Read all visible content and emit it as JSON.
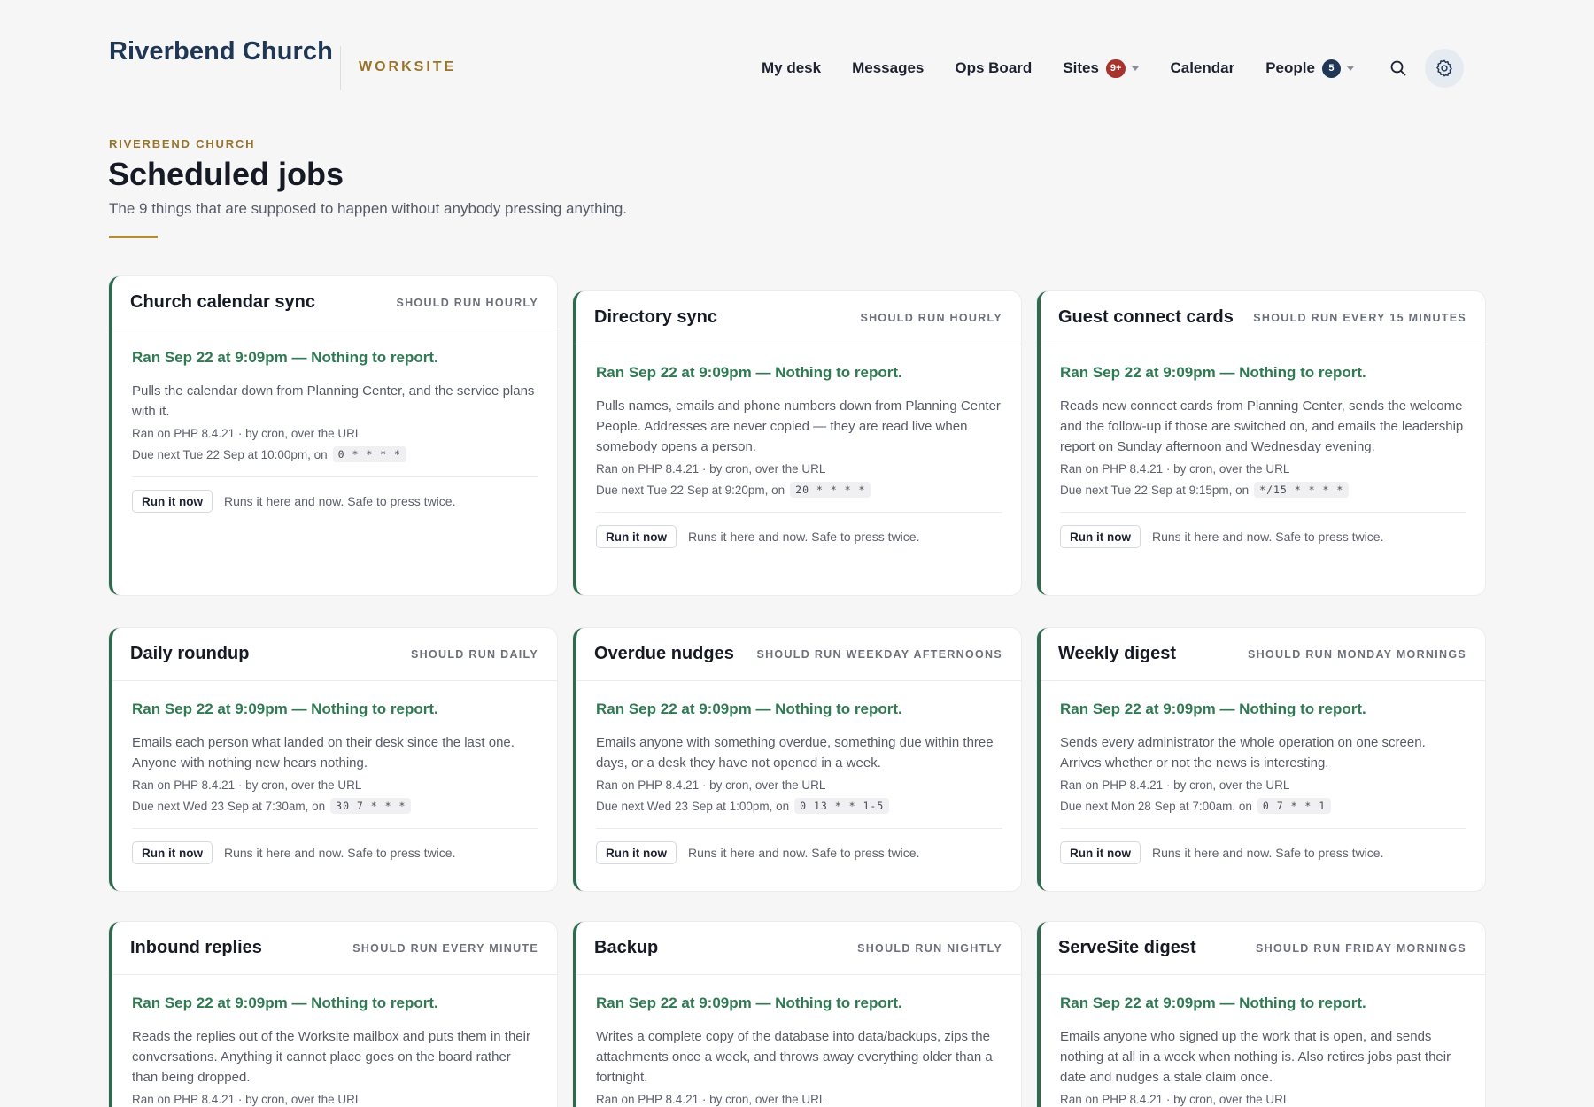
{
  "header": {
    "brand": "Riverbend Church",
    "brand_sub": "WORKSITE",
    "nav": {
      "my_desk": "My desk",
      "messages": "Messages",
      "ops_board": "Ops Board",
      "sites": "Sites",
      "sites_badge": "9+",
      "calendar": "Calendar",
      "people": "People",
      "people_badge": "5"
    },
    "icons": [
      "search-icon",
      "gear-icon",
      "chevron-down-icon"
    ]
  },
  "page": {
    "eyebrow": "RIVERBEND CHURCH",
    "title": "Scheduled jobs",
    "subtitle": "The 9 things that are supposed to happen without anybody pressing anything."
  },
  "colors": {
    "accent_gold": "#98742b",
    "brand_navy": "#1f3655",
    "status_green": "#2f7a52",
    "card_border_green": "#2f6a4f",
    "badge_red": "#a8322d"
  },
  "jobs": [
    {
      "title": "Church calendar sync",
      "frequency": "SHOULD RUN HOURLY",
      "status": "Ran Sep 22 at 9:09pm — Nothing to report.",
      "description": "Pulls the calendar down from Planning Center, and the service plans with it.",
      "meta": "Ran on PHP 8.4.21 · by cron, over the URL",
      "due": "Due next Tue 22 Sep at 10:00pm, on",
      "cron": "0 * * * *",
      "button": "Run it now",
      "note": "Runs it here and now. Safe to press twice."
    },
    {
      "title": "Directory sync",
      "frequency": "SHOULD RUN HOURLY",
      "status": "Ran Sep 22 at 9:09pm — Nothing to report.",
      "description": "Pulls names, emails and phone numbers down from Planning Center People. Addresses are never copied — they are read live when somebody opens a person.",
      "meta": "Ran on PHP 8.4.21 · by cron, over the URL",
      "due": "Due next Tue 22 Sep at 9:20pm, on",
      "cron": "20 * * * *",
      "button": "Run it now",
      "note": "Runs it here and now. Safe to press twice."
    },
    {
      "title": "Guest connect cards",
      "frequency": "SHOULD RUN EVERY 15 MINUTES",
      "status": "Ran Sep 22 at 9:09pm — Nothing to report.",
      "description": "Reads new connect cards from Planning Center, sends the welcome and the follow-up if those are switched on, and emails the leadership report on Sunday afternoon and Wednesday evening.",
      "meta": "Ran on PHP 8.4.21 · by cron, over the URL",
      "due": "Due next Tue 22 Sep at 9:15pm, on",
      "cron": "*/15 * * * *",
      "button": "Run it now",
      "note": "Runs it here and now. Safe to press twice."
    },
    {
      "title": "Daily roundup",
      "frequency": "SHOULD RUN DAILY",
      "status": "Ran Sep 22 at 9:09pm — Nothing to report.",
      "description": "Emails each person what landed on their desk since the last one. Anyone with nothing new hears nothing.",
      "meta": "Ran on PHP 8.4.21 · by cron, over the URL",
      "due": "Due next Wed 23 Sep at 7:30am, on",
      "cron": "30 7 * * *",
      "button": "Run it now",
      "note": "Runs it here and now. Safe to press twice."
    },
    {
      "title": "Overdue nudges",
      "frequency": "SHOULD RUN WEEKDAY AFTERNOONS",
      "status": "Ran Sep 22 at 9:09pm — Nothing to report.",
      "description": "Emails anyone with something overdue, something due within three days, or a desk they have not opened in a week.",
      "meta": "Ran on PHP 8.4.21 · by cron, over the URL",
      "due": "Due next Wed 23 Sep at 1:00pm, on",
      "cron": "0 13 * * 1-5",
      "button": "Run it now",
      "note": "Runs it here and now. Safe to press twice."
    },
    {
      "title": "Weekly digest",
      "frequency": "SHOULD RUN MONDAY MORNINGS",
      "status": "Ran Sep 22 at 9:09pm — Nothing to report.",
      "description": "Sends every administrator the whole operation on one screen. Arrives whether or not the news is interesting.",
      "meta": "Ran on PHP 8.4.21 · by cron, over the URL",
      "due": "Due next Mon 28 Sep at 7:00am, on",
      "cron": "0 7 * * 1",
      "button": "Run it now",
      "note": "Runs it here and now. Safe to press twice."
    },
    {
      "title": "Inbound replies",
      "frequency": "SHOULD RUN EVERY MINUTE",
      "status": "Ran Sep 22 at 9:09pm — Nothing to report.",
      "description": "Reads the replies out of the Worksite mailbox and puts them in their conversations. Anything it cannot place goes on the board rather than being dropped.",
      "meta": "Ran on PHP 8.4.21 · by cron, over the URL",
      "due": "",
      "cron": "",
      "button": "",
      "note": ""
    },
    {
      "title": "Backup",
      "frequency": "SHOULD RUN NIGHTLY",
      "status": "Ran Sep 22 at 9:09pm — Nothing to report.",
      "description": "Writes a complete copy of the database into data/backups, zips the attachments once a week, and throws away everything older than a fortnight.",
      "meta": "Ran on PHP 8.4.21 · by cron, over the URL",
      "due": "",
      "cron": "",
      "button": "",
      "note": ""
    },
    {
      "title": "ServeSite digest",
      "frequency": "SHOULD RUN FRIDAY MORNINGS",
      "status": "Ran Sep 22 at 9:09pm — Nothing to report.",
      "description": "Emails anyone who signed up the work that is open, and sends nothing at all in a week when nothing is. Also retires jobs past their date and nudges a stale claim once.",
      "meta": "Ran on PHP 8.4.21 · by cron, over the URL",
      "due": "",
      "cron": "",
      "button": "",
      "note": ""
    }
  ]
}
